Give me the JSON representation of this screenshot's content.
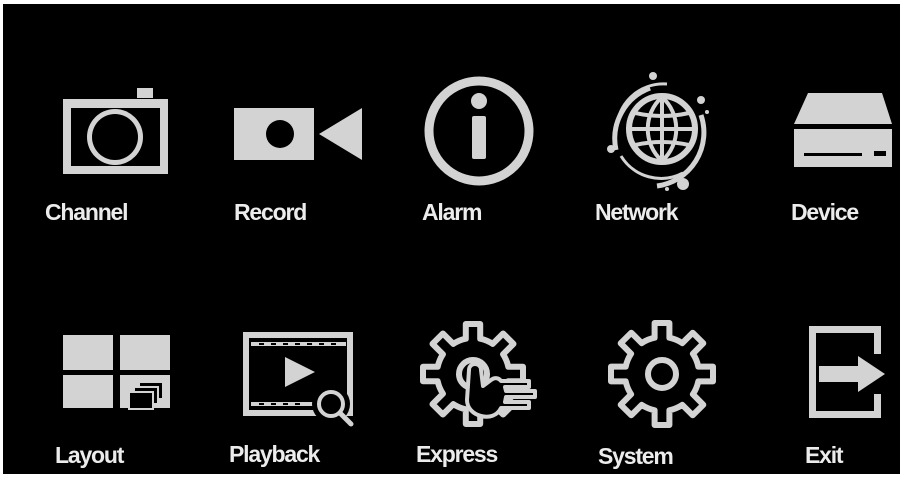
{
  "theme": {
    "background": "#000000",
    "icon_color": "#d3d3d3",
    "text_color": "#ececec"
  },
  "menu": {
    "row1": [
      {
        "label": "Channel",
        "icon": "camera-icon"
      },
      {
        "label": "Record",
        "icon": "video-camera-icon"
      },
      {
        "label": "Alarm",
        "icon": "info-icon"
      },
      {
        "label": "Network",
        "icon": "globe-network-icon"
      },
      {
        "label": "Device",
        "icon": "hard-drive-icon"
      }
    ],
    "row2": [
      {
        "label": "Layout",
        "icon": "multi-window-layout-icon"
      },
      {
        "label": "Playback",
        "icon": "video-search-icon"
      },
      {
        "label": "Express",
        "icon": "gear-hand-icon"
      },
      {
        "label": "System",
        "icon": "gear-icon"
      },
      {
        "label": "Exit",
        "icon": "exit-door-icon"
      }
    ]
  }
}
